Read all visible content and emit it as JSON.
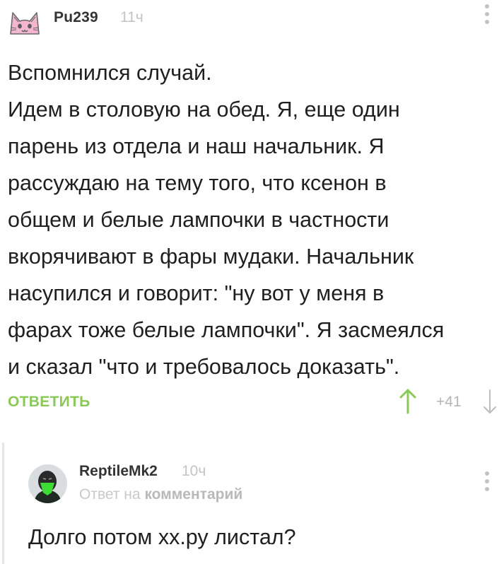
{
  "comment": {
    "author": "Pu239",
    "time": "11ч",
    "avatar_icon": "cat-face-icon",
    "body_lines": [
      "Вспомнился случай.",
      "Идем в столовую на обед. Я, еще один",
      "парень из отдела и наш начальник. Я",
      "рассуждаю на тему того, что ксенон в",
      "общем и белые лампочки в частности",
      "вкорячивают в фары мудаки. Начальник",
      "насупился и говорит: \"ну вот у меня в",
      "фарах тоже белые лампочки\". Я засмеялся",
      "и сказал \"что и требовалось доказать\"."
    ],
    "reply_label": "ОТВЕТИТЬ",
    "rating": "+41"
  },
  "reply": {
    "author": "ReptileMk2",
    "time": "10ч",
    "meta_prefix": "Ответ на",
    "meta_link": "комментарий",
    "text": "Долго потом хх.ру листал?"
  },
  "colors": {
    "accent_green": "#8ac858",
    "muted_gray": "#c4c4c4",
    "text_dark": "#1f1f1f"
  }
}
